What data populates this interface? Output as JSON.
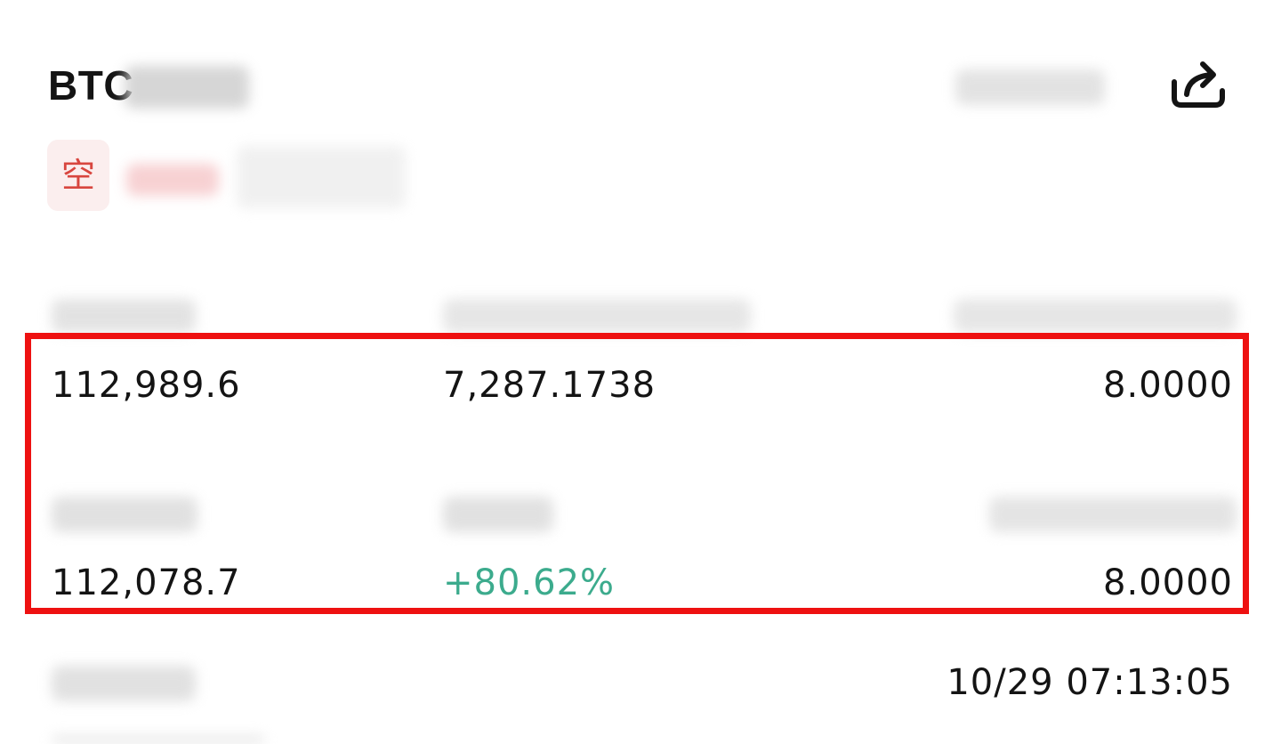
{
  "header": {
    "symbol": "BTC",
    "share_icon": "share-icon"
  },
  "position": {
    "side_label": "空"
  },
  "row1": {
    "entry_price": "112,989.6",
    "amount": "7,287.1738",
    "max_size": "8.0000"
  },
  "row2": {
    "close_price": "112,078.7",
    "pnl_rate": "+80.62%",
    "closed_size": "8.0000"
  },
  "row3": {
    "time": "10/29 07:13:05"
  },
  "colors": {
    "profit_green": "#3cab8d",
    "short_red": "#d8463f",
    "highlight_red": "#ee1111"
  }
}
